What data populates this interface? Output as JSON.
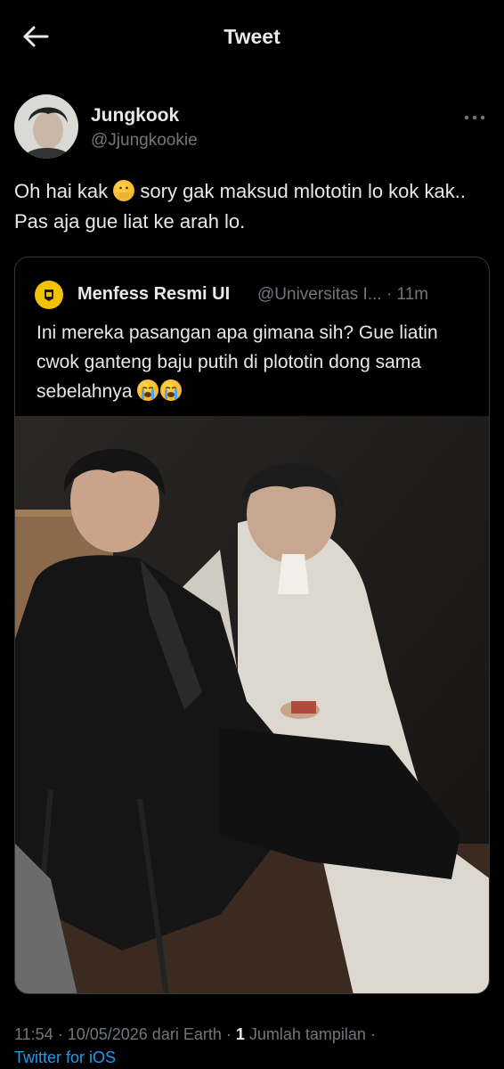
{
  "header": {
    "title": "Tweet",
    "back_icon": "arrow-left-icon"
  },
  "tweet": {
    "author_name": "Jungkook",
    "author_handle": "@Jjungkookie",
    "text_part1": "Oh hai kak ",
    "text_emoji": "hand-over-mouth-emoji",
    "text_part2": " sory gak maksud mlototin lo kok kak.. Pas aja gue liat ke arah lo.",
    "more_icon": "more-horizontal-icon"
  },
  "quote": {
    "author_name": "Menfess Resmi UI",
    "author_handle": "@Universitas I...",
    "separator": "·",
    "time": "11m",
    "text": "Ini mereka pasangan apa gimana sih? Gue liatin cwok ganteng baju putih di plototin dong sama sebelahnya ",
    "emoji": "loudly-crying-face-emoji x2",
    "media_description_icon": "photo"
  },
  "footer": {
    "time": "11:54",
    "sep1": " · ",
    "date": "10/05/2026 dari Earth",
    "sep2": " · ",
    "views_count": "1",
    "views_label": " Jumlah tampilan",
    "sep3": " ·",
    "source": "Twitter for iOS"
  },
  "colors": {
    "background": "#000000",
    "text_primary": "#e7e9ea",
    "text_secondary": "#71767b",
    "link": "#1d9bf0",
    "border": "#333639"
  }
}
